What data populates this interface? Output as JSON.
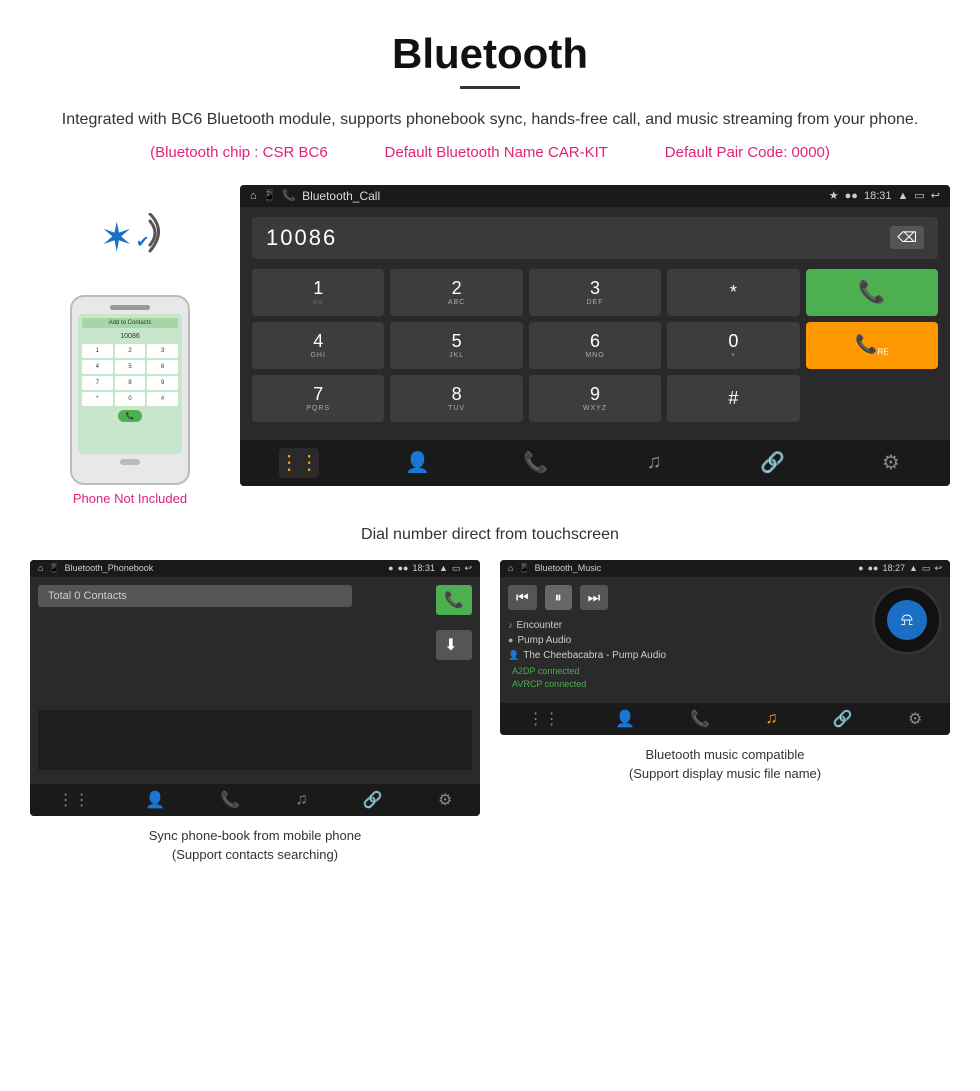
{
  "header": {
    "title": "Bluetooth",
    "description": "Integrated with BC6 Bluetooth module, supports phonebook sync, hands-free call, and music streaming from your phone.",
    "specs": {
      "chip": "(Bluetooth chip : CSR BC6",
      "name": "Default Bluetooth Name CAR-KIT",
      "code": "Default Pair Code: 0000)"
    }
  },
  "phone_side": {
    "not_included": "Phone Not Included"
  },
  "main_screen": {
    "statusbar": {
      "app_name": "Bluetooth_Call",
      "time": "18:31",
      "bt_icon": "⚡",
      "signal": "●",
      "wifi": "●"
    },
    "dial_number": "10086",
    "backspace": "✕",
    "keys": [
      {
        "num": "1",
        "letters": "○○"
      },
      {
        "num": "2",
        "letters": "ABC"
      },
      {
        "num": "3",
        "letters": "DEF"
      },
      {
        "num": "*",
        "letters": ""
      },
      {
        "num": "",
        "letters": "call"
      },
      {
        "num": "4",
        "letters": "GHI"
      },
      {
        "num": "5",
        "letters": "JKL"
      },
      {
        "num": "6",
        "letters": "MNO"
      },
      {
        "num": "0",
        "letters": "+"
      },
      {
        "num": "",
        "letters": "recall"
      },
      {
        "num": "7",
        "letters": "PQRS"
      },
      {
        "num": "8",
        "letters": "TUV"
      },
      {
        "num": "9",
        "letters": "WXYZ"
      },
      {
        "num": "#",
        "letters": ""
      },
      {
        "num": "",
        "letters": ""
      }
    ],
    "bottom_nav": [
      "⊞",
      "👤",
      "📞",
      "♪",
      "🔗",
      "⚙"
    ]
  },
  "main_caption": "Dial number direct from touchscreen",
  "phonebook_screen": {
    "app_name": "Bluetooth_Phonebook",
    "time": "18:31",
    "search_placeholder": "Total 0 Contacts",
    "bottom_nav": [
      "⊞",
      "👤",
      "📞",
      "♪",
      "🔗",
      "⚙"
    ]
  },
  "phonebook_caption": {
    "line1": "Sync phone-book from mobile phone",
    "line2": "(Support contacts searching)"
  },
  "music_screen": {
    "app_name": "Bluetooth_Music",
    "time": "18:27",
    "tracks": [
      {
        "icon": "♪",
        "name": "Encounter"
      },
      {
        "icon": "○",
        "name": "Pump Audio"
      },
      {
        "icon": "👤",
        "name": "The Cheebacabra - Pump Audio"
      }
    ],
    "status": [
      "A2DP connected",
      "AVRCP connected"
    ],
    "bottom_nav": [
      "⊞",
      "👤",
      "📞",
      "♪",
      "🔗",
      "⚙"
    ]
  },
  "music_caption": {
    "line1": "Bluetooth music compatible",
    "line2": "(Support display music file name)"
  }
}
